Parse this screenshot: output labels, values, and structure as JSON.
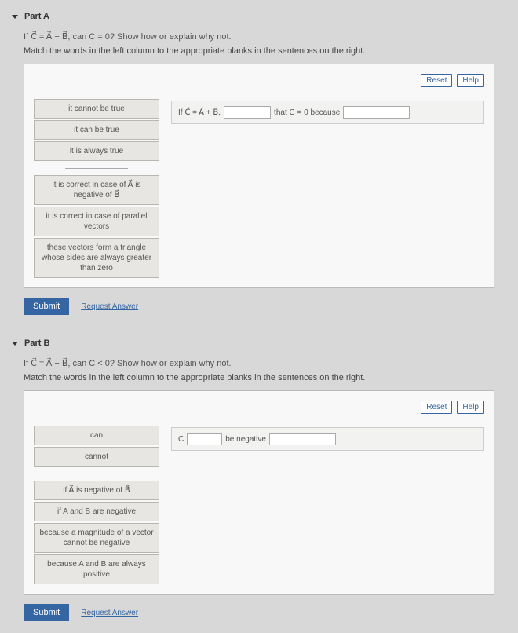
{
  "partA": {
    "title": "Part A",
    "prompt": "If C⃗ = A⃗ + B⃗, can C = 0? Show how or explain why not.",
    "instruction": "Match the words in the left column to the appropriate blanks in the sentences on the right.",
    "reset": "Reset",
    "help": "Help",
    "tiles1": [
      "it cannot be true",
      "it can be true",
      "it is always true"
    ],
    "tiles2": [
      "it is correct in case of A⃗ is negative of B⃗",
      "it is correct in case of parallel vectors",
      "these vectors form a triangle whose sides are always greater than zero"
    ],
    "sentence": {
      "s1": "If C⃗ = A⃗ + B⃗,",
      "s2": "that C = 0 because"
    },
    "submit": "Submit",
    "request": "Request Answer"
  },
  "partB": {
    "title": "Part B",
    "prompt": "If C⃗ = A⃗ + B⃗, can C < 0? Show how or explain why not.",
    "instruction": "Match the words in the left column to the appropriate blanks in the sentences on the right.",
    "reset": "Reset",
    "help": "Help",
    "tiles1": [
      "can",
      "cannot"
    ],
    "tiles2": [
      "if A⃗ is negative of B⃗",
      "if A and B are negative",
      "because a magnitude of a vector cannot be negative",
      "because A and B are always positive"
    ],
    "sentence": {
      "s1": "C",
      "s2": "be negative"
    },
    "submit": "Submit",
    "request": "Request Answer"
  }
}
